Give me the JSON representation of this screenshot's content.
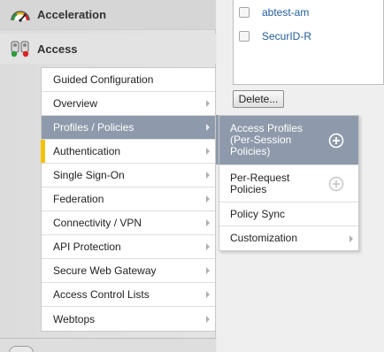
{
  "nav": {
    "acceleration_label": "Acceleration",
    "access_label": "Access"
  },
  "submenu": {
    "items": [
      {
        "label": "Guided Configuration",
        "has_arrow": false
      },
      {
        "label": "Overview",
        "has_arrow": true
      },
      {
        "label": "Profiles / Policies",
        "has_arrow": true,
        "active": true
      },
      {
        "label": "Authentication",
        "has_arrow": true,
        "marked": true
      },
      {
        "label": "Single Sign-On",
        "has_arrow": true
      },
      {
        "label": "Federation",
        "has_arrow": true
      },
      {
        "label": "Connectivity / VPN",
        "has_arrow": true
      },
      {
        "label": "API Protection",
        "has_arrow": true
      },
      {
        "label": "Secure Web Gateway",
        "has_arrow": true
      },
      {
        "label": "Access Control Lists",
        "has_arrow": true
      },
      {
        "label": "Webtops",
        "has_arrow": true
      }
    ]
  },
  "flyout": {
    "access_profiles": "Access Profiles (Per-Session Policies)",
    "per_request": "Per-Request Policies",
    "policy_sync": "Policy Sync",
    "customization": "Customization"
  },
  "content": {
    "list_items": [
      "abtest-am",
      "SecurID-R"
    ],
    "delete_label": "Delete..."
  },
  "colors": {
    "active_bg": "#8e9aab",
    "marker": "#f3c300",
    "link": "#1f5c99"
  }
}
